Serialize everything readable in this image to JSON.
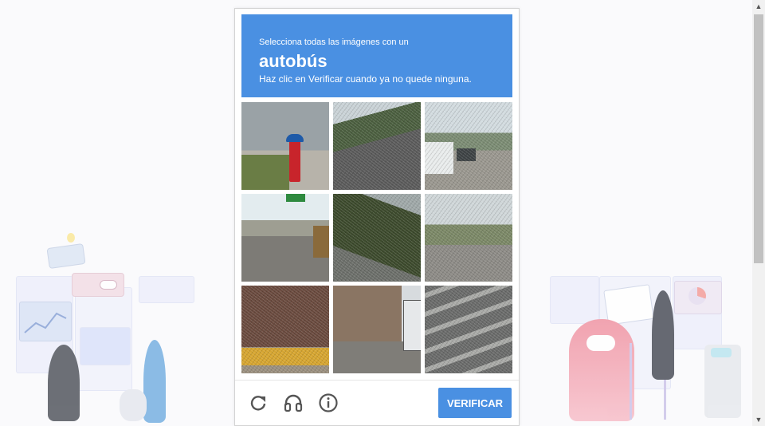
{
  "captcha": {
    "instruction_small": "Selecciona todas las imágenes con un",
    "target_word": "autobús",
    "instruction_sub": "Haz clic en Verificar cuando ya no quede ninguna.",
    "tiles": [
      {
        "desc": "fire-hydrant"
      },
      {
        "desc": "road"
      },
      {
        "desc": "street-with-cars"
      },
      {
        "desc": "overpass"
      },
      {
        "desc": "road-noisy"
      },
      {
        "desc": "road-trees"
      },
      {
        "desc": "building-with-bus"
      },
      {
        "desc": "building-corner-bus"
      },
      {
        "desc": "crosswalk"
      }
    ],
    "verify_label": "VERIFICAR"
  },
  "icons": {
    "reload": "reload-icon",
    "audio": "headphones-icon",
    "info": "info-icon"
  },
  "colors": {
    "accent": "#4a90e2"
  }
}
